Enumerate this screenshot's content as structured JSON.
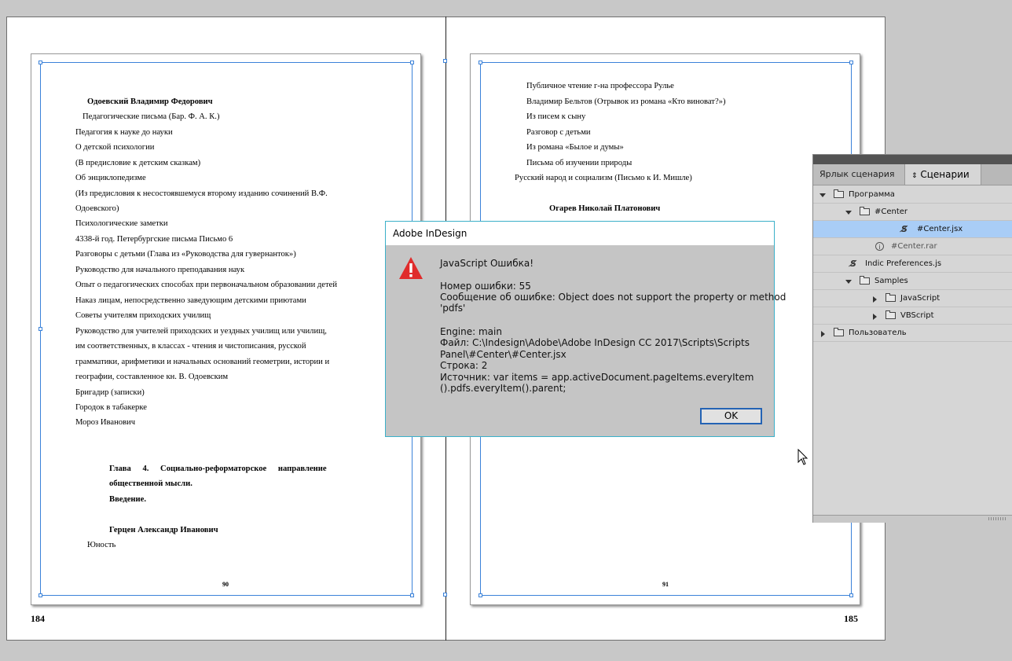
{
  "left_page": {
    "lines": [
      {
        "text": "Одоевский Владимир Федорович",
        "bold": true
      },
      {
        "text": "Педагогические письма (Бар. Ф. А. К.)"
      },
      {
        "text": "Педагогия к науке до науки"
      },
      {
        "text": "О детской психологии"
      },
      {
        "text": "(В предисловие к детским сказкам)"
      },
      {
        "text": "Об энциклопедизме"
      },
      {
        "text": "(Из предисловия к несостоявшемуся второму изданию сочинений В.Ф."
      },
      {
        "text": "Одоевского)"
      },
      {
        "text": "Психологические заметки"
      },
      {
        "text": "4338-й год. Петербургские письма  Письмо 6"
      },
      {
        "text": "Разговоры с детьми (Глава из «Руководства для гувернанток»)"
      },
      {
        "text": "Руководство для начального преподавания наук"
      },
      {
        "text": "Опыт о педагогических способах при первоначальном образовании детей"
      },
      {
        "text": "Наказ лицам, непосредственно заведующим детскими приютами"
      },
      {
        "text": "Советы учителям приходских училищ"
      },
      {
        "text": "Руководство для  учителей приходских и уездных училищ  или училищ,"
      },
      {
        "text": "им соответственных, в классах - чтения и чистописания, русской"
      },
      {
        "text": "грамматики, арифметики и начальных оснований геометрии, истории и"
      },
      {
        "text": "географии, составленное кн. В. Одоевским"
      },
      {
        "text": "Бригадир (записки)"
      },
      {
        "text": "Городок в табакерке"
      },
      {
        "text": "Мороз Иванович"
      },
      {
        "text": "Глава 4. Социально-реформаторское направление",
        "bold": true
      },
      {
        "text": "общественной мысли.",
        "bold": true
      },
      {
        "text": "Введение.",
        "bold": true
      },
      {
        "text": "Герцен Александр Иванович",
        "bold": true
      },
      {
        "text": "Юность"
      }
    ],
    "page_number": "90",
    "folio": "184"
  },
  "right_page": {
    "lines": [
      {
        "text": "Публичное чтение г-на профессора Рулье"
      },
      {
        "text": "Владимир Бельтов (Отрывок из романа «Кто виноват?»)"
      },
      {
        "text": "Из писем к сыну"
      },
      {
        "text": "Разговор с детьми"
      },
      {
        "text": "Из романа «Былое и думы»"
      },
      {
        "text": "Письма об изучении природы"
      },
      {
        "text": "Русский народ и социализм (Письмо к И. Мишле)"
      },
      {
        "text": "Огарев Николай Платонович",
        "bold": true
      }
    ],
    "page_number": "91",
    "folio": "185"
  },
  "dialog": {
    "title": "Adobe InDesign",
    "heading": "JavaScript Ошибка!",
    "error_number": "Номер ошибки: 55",
    "message_1": "Сообщение об ошибке: Object does not support the property or method",
    "message_2": "'pdfs'",
    "engine": "Engine: main",
    "file_1": "Файл: C:\\Indesign\\Adobe\\Adobe InDesign CC 2017\\Scripts\\Scripts",
    "file_2": "Panel\\#Center\\#Center.jsx",
    "line": "Строка: 2",
    "source_1": "Источник: var items = app.activeDocument.pageItems.everyItem",
    "source_2": "().pdfs.everyItem().parent;",
    "ok_label": "OK",
    "warning_icon": "warning-triangle-icon",
    "accent": "#3bb0c9"
  },
  "panel": {
    "tab_label": "Ярлык сценария",
    "tab_scripts": "Сценарии",
    "items": [
      {
        "label": "Программа",
        "type": "folder",
        "expand": "down",
        "level": 0
      },
      {
        "label": "#Center",
        "type": "folder",
        "expand": "down",
        "level": 1
      },
      {
        "label": "#Center.jsx",
        "type": "script",
        "level": 2,
        "selected": true
      },
      {
        "label": "#Center.rar",
        "type": "info",
        "level": 1,
        "dim": true
      },
      {
        "label": "Indic Preferences.js",
        "type": "script",
        "level": 0
      },
      {
        "label": "Samples",
        "type": "folder",
        "expand": "down",
        "level": 1
      },
      {
        "label": "JavaScript",
        "type": "folder",
        "expand": "right",
        "level": 2
      },
      {
        "label": "VBScript",
        "type": "folder",
        "expand": "right",
        "level": 2
      },
      {
        "label": "Пользователь",
        "type": "folder",
        "expand": "right",
        "level": 0
      }
    ]
  }
}
